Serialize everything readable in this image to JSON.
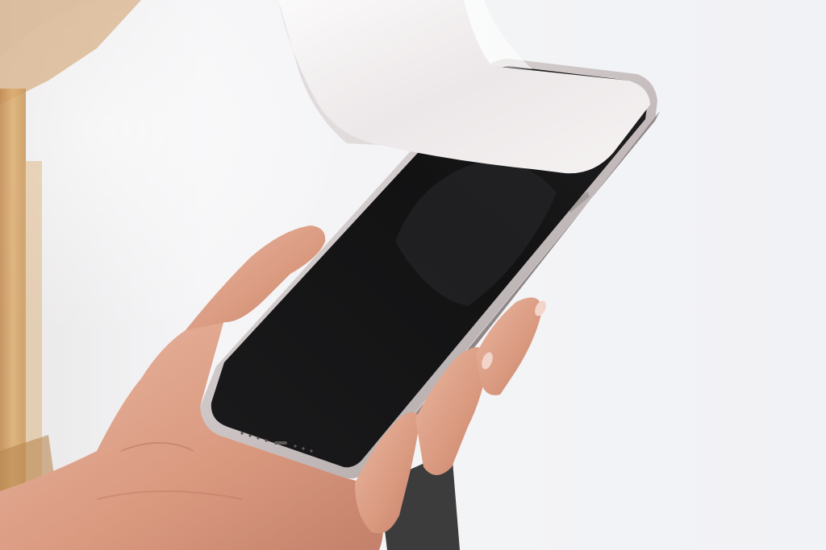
{
  "scene": {
    "subject": "hand-holding-smartphone-peeling-screen-film",
    "colors": {
      "background": "#f4f4f6",
      "wood": "#c98a3f",
      "wood_dark": "#a86a2a",
      "phone_frame": "#d2cbcb",
      "phone_frame_shade": "#b2aaaa",
      "screen": "#141415",
      "film": "#f1edee",
      "skin": "#e3a892",
      "skin_shadow": "#c98672"
    }
  }
}
